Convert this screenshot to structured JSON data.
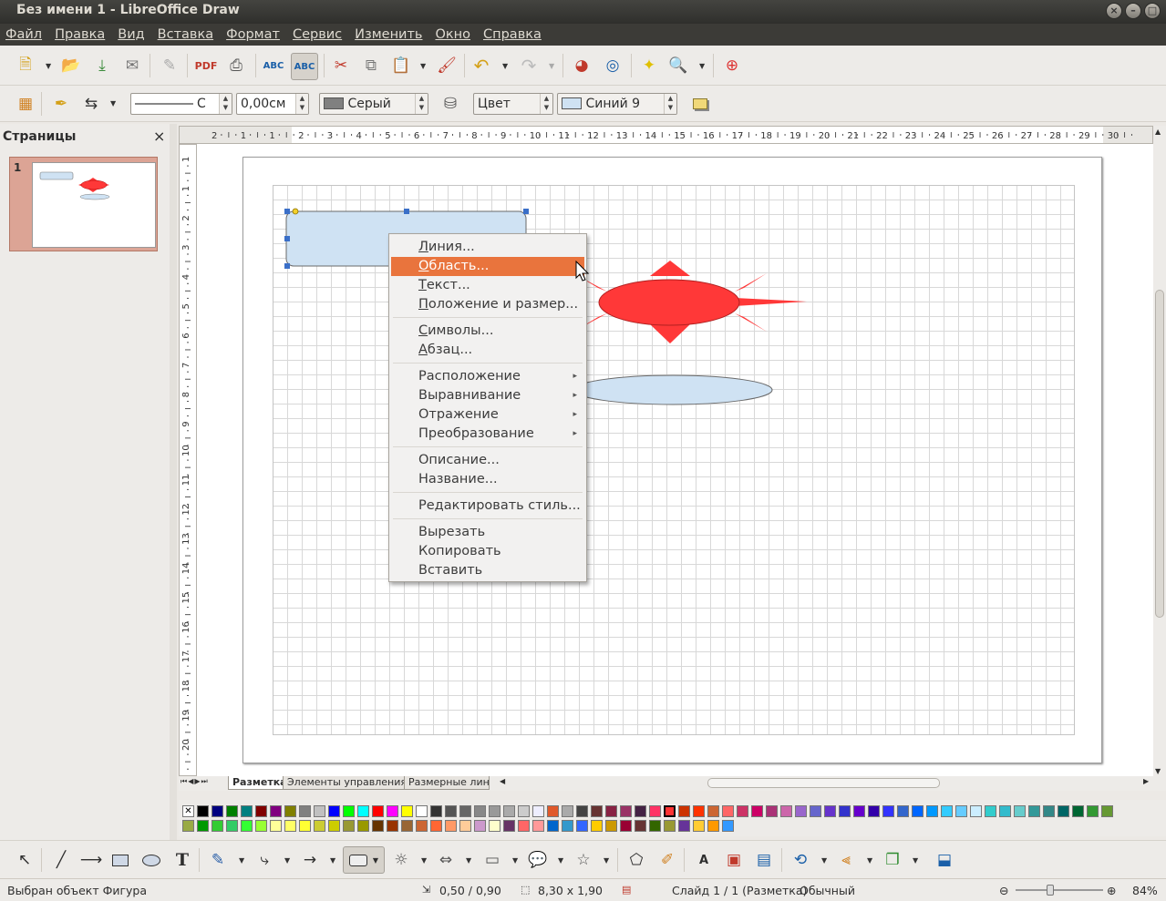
{
  "window": {
    "title": "Без имени 1 - LibreOffice Draw"
  },
  "menubar": [
    "Файл",
    "Правка",
    "Вид",
    "Вставка",
    "Формат",
    "Сервис",
    "Изменить",
    "Окно",
    "Справка"
  ],
  "line_props": {
    "line_width": "0,00см",
    "line_color": "Серый",
    "line_style_suffix": "С",
    "area_type": "Цвет",
    "area_color": "Синий 9"
  },
  "pages_pane": {
    "title": "Страницы",
    "close": "×",
    "page_number": "1"
  },
  "ruler": {
    "h_ticks": [
      "2",
      "1",
      "1",
      "2",
      "3",
      "4",
      "5",
      "6",
      "7",
      "8",
      "9",
      "10",
      "11",
      "12",
      "13",
      "14",
      "15",
      "16",
      "17",
      "18",
      "19",
      "20",
      "21",
      "22",
      "23",
      "24",
      "25",
      "26",
      "27",
      "28",
      "29",
      "30"
    ],
    "v_ticks": [
      "1",
      "1",
      "2",
      "3",
      "4",
      "5",
      "6",
      "7",
      "8",
      "9",
      "10",
      "11",
      "12",
      "13",
      "14",
      "15",
      "16",
      "17",
      "18",
      "19",
      "20"
    ]
  },
  "tabs": [
    "Разметка",
    "Элементы управления",
    "Размерные лини"
  ],
  "context_menu": {
    "groups": [
      [
        {
          "label": "Линия...",
          "u": "Л"
        },
        {
          "label": "Область...",
          "u": "О",
          "highlighted": true
        },
        {
          "label": "Текст...",
          "u": "Т"
        },
        {
          "label": "Положение и размер...",
          "u": "П"
        }
      ],
      [
        {
          "label": "Символы...",
          "u": "С"
        },
        {
          "label": "Абзац...",
          "u": "А"
        }
      ],
      [
        {
          "label": "Расположение",
          "submenu": true
        },
        {
          "label": "Выравнивание",
          "submenu": true
        },
        {
          "label": "Отражение",
          "submenu": true
        },
        {
          "label": "Преобразование",
          "submenu": true
        }
      ],
      [
        {
          "label": "Описание..."
        },
        {
          "label": "Название..."
        }
      ],
      [
        {
          "label": "Редактировать стиль..."
        }
      ],
      [
        {
          "label": "Вырезать"
        },
        {
          "label": "Копировать"
        },
        {
          "label": "Вставить"
        }
      ]
    ]
  },
  "status": {
    "selection": "Выбран объект Фигура",
    "position": "0,50 / 0,90",
    "size": "8,30 x 1,90",
    "slide": "Слайд 1 / 1 (Разметка)",
    "layout": "Обычный",
    "zoom": "84%"
  },
  "colors": {
    "accent": "#e9743d",
    "shape_fill": "#cfe2f3",
    "sun_fill": "#ff3838",
    "titlebar": "#3c3b37",
    "palette_row1": [
      "#000000",
      "#000080",
      "#008000",
      "#008080",
      "#800000",
      "#800080",
      "#808000",
      "#808080",
      "#c0c0c0",
      "#0000ff",
      "#00ff00",
      "#00ffff",
      "#ff0000",
      "#ff00ff",
      "#ffff00",
      "#ffffff",
      "#333333",
      "#555555",
      "#666666",
      "#888888",
      "#999999",
      "#aaaaaa",
      "#cccccc",
      "#eeeeff",
      "#e0592b",
      "#aaaaaa",
      "#444444",
      "#663333",
      "#882244",
      "#993366",
      "#442244",
      "#ff3366",
      "#ff3333",
      "#cc3300",
      "#ff3300",
      "#cc6633",
      "#ff6666",
      "#cc3366",
      "#cc0066",
      "#aa3377",
      "#cc66aa",
      "#9966cc",
      "#6666cc",
      "#6633cc",
      "#3333cc",
      "#6600cc",
      "#3300aa",
      "#3333ff",
      "#3366cc",
      "#0066ff",
      "#0099ff",
      "#33ccff",
      "#66ccff",
      "#cceeff",
      "#33cccc",
      "#33bbcc",
      "#66cccc",
      "#339999",
      "#338888",
      "#006666",
      "#006633",
      "#339933",
      "#669933"
    ],
    "palette_row2": [
      "#99aa44",
      "#009900",
      "#33cc33",
      "#33cc66",
      "#33ff33",
      "#99ff33",
      "#ffff99",
      "#ffff66",
      "#ffff33",
      "#cccc33",
      "#cccc00",
      "#999933",
      "#999900",
      "#663300",
      "#993300",
      "#996633",
      "#cc6633",
      "#ff6633",
      "#ff9966",
      "#ffcc99",
      "#cc99cc",
      "#ffffcc",
      "#663366",
      "#ff6666",
      "#ff9999",
      "#0066cc",
      "#3399cc",
      "#3366ff",
      "#ffcc00",
      "#cc9900",
      "#990033",
      "#663333",
      "#336600",
      "#999933",
      "#663399",
      "#ffcc33",
      "#ff9900",
      "#3399ff"
    ]
  }
}
